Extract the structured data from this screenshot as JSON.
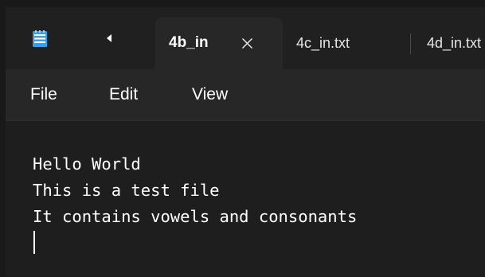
{
  "tabs": {
    "active": {
      "label": "4b_in",
      "close_glyph": "✕"
    },
    "inactive": [
      {
        "label": "4c_in.txt"
      },
      {
        "label": "4d_in.txt"
      }
    ],
    "scroll_left_icon": "triangle-left-icon",
    "app_icon": "notepad-icon"
  },
  "menu": {
    "file": "File",
    "edit": "Edit",
    "view": "View"
  },
  "editor": {
    "content": "Hello World\nThis is a test file\nIt contains vowels and consonants"
  },
  "colors": {
    "titlebar": "#202020",
    "active_tab": "#272727",
    "editor_bg": "#1e1e1e",
    "text": "#ffffff",
    "notepad_blue": "#3b9ee8"
  }
}
